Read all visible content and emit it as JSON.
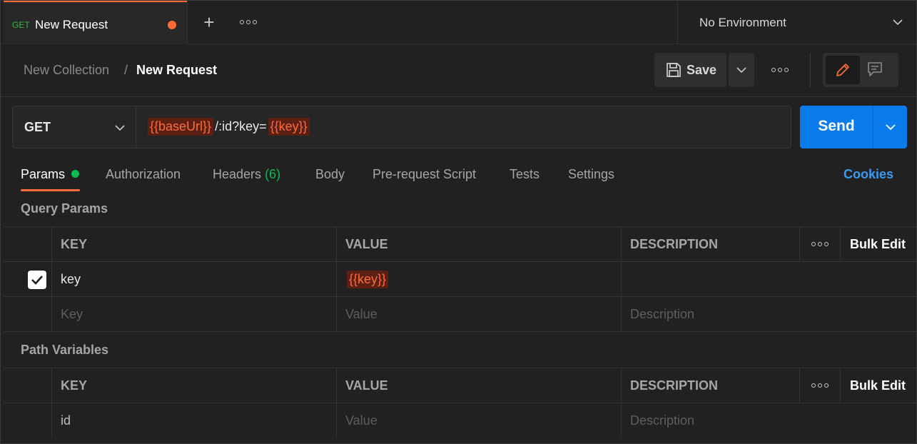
{
  "tabbar": {
    "active_tab": {
      "method": "GET",
      "name": "New Request",
      "unsaved": true
    },
    "new_tab_icon": "plus-icon",
    "more_icon": "more-horizontal-icon",
    "environment": "No Environment"
  },
  "header": {
    "breadcrumb": {
      "collection": "New Collection",
      "separator": "/",
      "current": "New Request"
    },
    "save_label": "Save",
    "icons": {
      "save": "floppy-disk-icon",
      "edit": "pencil-icon",
      "comment": "comment-icon"
    }
  },
  "request": {
    "method": "GET",
    "url_parts": [
      {
        "text": "{{baseUrl}}",
        "variable": true
      },
      {
        "text": "/:id?key=",
        "variable": false
      },
      {
        "text": "{{key}}",
        "variable": true
      }
    ],
    "send_label": "Send"
  },
  "subtabs": {
    "params": "Params",
    "authorization": "Authorization",
    "headers": "Headers",
    "headers_count": "(6)",
    "body": "Body",
    "pre_request": "Pre-request Script",
    "tests": "Tests",
    "settings": "Settings",
    "cookies": "Cookies"
  },
  "query_params": {
    "title": "Query Params",
    "columns": {
      "key": "KEY",
      "value": "VALUE",
      "description": "DESCRIPTION",
      "bulk_edit": "Bulk Edit"
    },
    "rows": [
      {
        "checked": true,
        "key": "key",
        "value": "{{key}}",
        "description": ""
      }
    ],
    "placeholder": {
      "key": "Key",
      "value": "Value",
      "description": "Description"
    }
  },
  "path_variables": {
    "title": "Path Variables",
    "columns": {
      "key": "KEY",
      "value": "VALUE",
      "description": "DESCRIPTION",
      "bulk_edit": "Bulk Edit"
    },
    "rows": [
      {
        "key": "id",
        "value_placeholder": "Value",
        "description_placeholder": "Description"
      }
    ]
  },
  "colors": {
    "accent": "#ff6c37",
    "send": "#097bed",
    "success": "#0cbb52",
    "link": "#3d9bf5"
  }
}
